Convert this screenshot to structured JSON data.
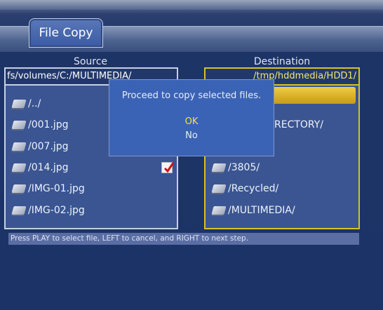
{
  "title": "File Copy",
  "source": {
    "heading": "Source",
    "path": "fs/volumes/C:/MULTIMEDIA/",
    "items": [
      {
        "name": "/../",
        "checked": false
      },
      {
        "name": "/001.jpg",
        "checked": false
      },
      {
        "name": "/007.jpg",
        "checked": false
      },
      {
        "name": "/014.jpg",
        "checked": true
      },
      {
        "name": "/IMG-01.jpg",
        "checked": false
      },
      {
        "name": "/IMG-02.jpg",
        "checked": false
      }
    ]
  },
  "destination": {
    "heading": "Destination",
    "path": "/tmp/hddmedia/HDD1/",
    "items": [
      {
        "name": ""
      },
      {
        "name": "RECTORY/"
      },
      {
        "name": ""
      },
      {
        "name": "/3805/"
      },
      {
        "name": "/Recycled/"
      },
      {
        "name": "/MULTIMEDIA/"
      }
    ]
  },
  "dialog": {
    "message": "Proceed to copy selected files.",
    "ok": "OK",
    "no": "No"
  },
  "status": "Press PLAY to select file, LEFT to cancel, and RIGHT to next step.",
  "colors": {
    "background": "#1c3367",
    "panel": "#3a5592",
    "dest_border": "#d9c21e",
    "highlight": "#e0b72c",
    "dialog": "#3b63b5",
    "ok_text": "#f2e34a"
  }
}
